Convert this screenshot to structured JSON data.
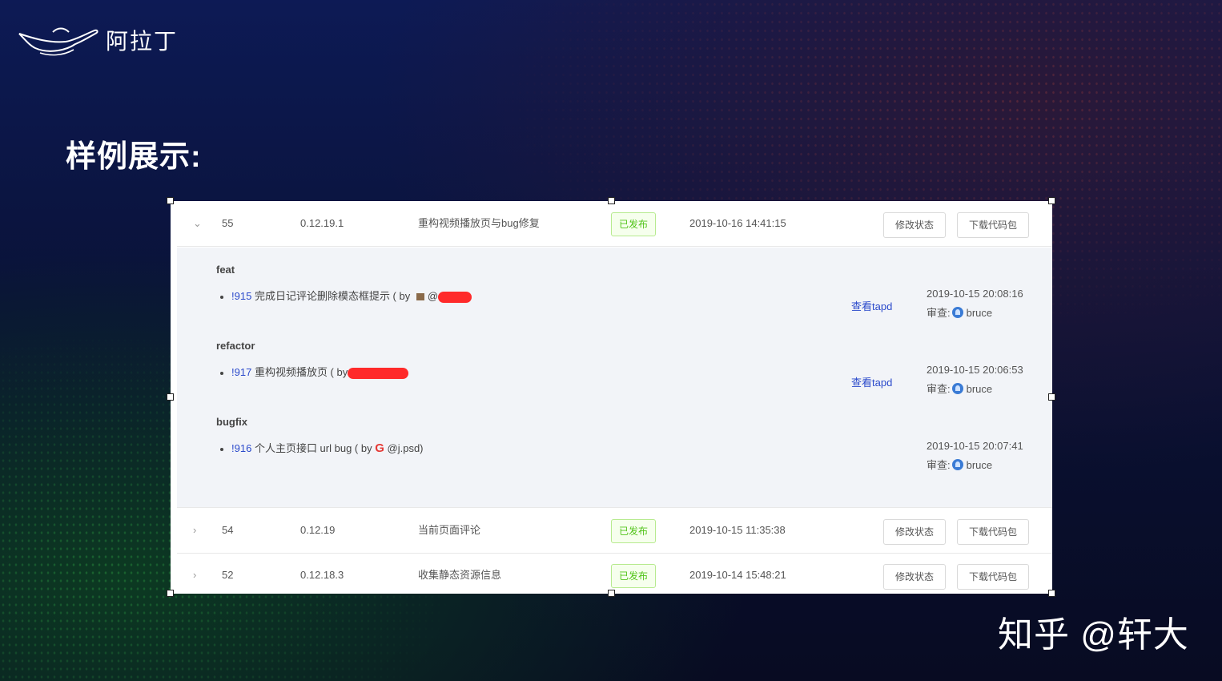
{
  "brand": {
    "name": "阿拉丁"
  },
  "slide": {
    "title": "样例展示:"
  },
  "watermark": "知乎 @轩大",
  "releases": [
    {
      "id": "55",
      "version": "0.12.19.1",
      "title": "重构视频播放页与bug修复",
      "status": "已发布",
      "time": "2019-10-16 14:41:15",
      "expanded": true
    },
    {
      "id": "54",
      "version": "0.12.19",
      "title": "当前页面评论",
      "status": "已发布",
      "time": "2019-10-15 11:35:38",
      "expanded": false
    },
    {
      "id": "52",
      "version": "0.12.18.3",
      "title": "收集静态资源信息",
      "status": "已发布",
      "time": "2019-10-14 15:48:21",
      "expanded": false
    }
  ],
  "actions": {
    "change_status": "修改状态",
    "download": "下载代码包"
  },
  "details": {
    "groups": [
      {
        "type": "feat",
        "mr": "!915",
        "desc": "完成日记评论删除模态框提示 ( by",
        "author": "@",
        "tapd": "查看tapd",
        "time": "2019-10-15 20:08:16",
        "review_label": "审查:",
        "reviewer": "bruce"
      },
      {
        "type": "refactor",
        "mr": "!917",
        "desc": "重构视频播放页 ( by",
        "author": "",
        "tapd": "查看tapd",
        "time": "2019-10-15 20:06:53",
        "review_label": "审查:",
        "reviewer": "bruce"
      },
      {
        "type": "bugfix",
        "mr": "!916",
        "desc": "个人主页接口 url bug ( by",
        "author": "@j.psd)",
        "tapd": "",
        "time": "2019-10-15 20:07:41",
        "review_label": "审查:",
        "reviewer": "bruce"
      }
    ]
  },
  "colors": {
    "link": "#2b4acb",
    "badge_green": "#52c41a",
    "background_navy": "#0a1237"
  }
}
